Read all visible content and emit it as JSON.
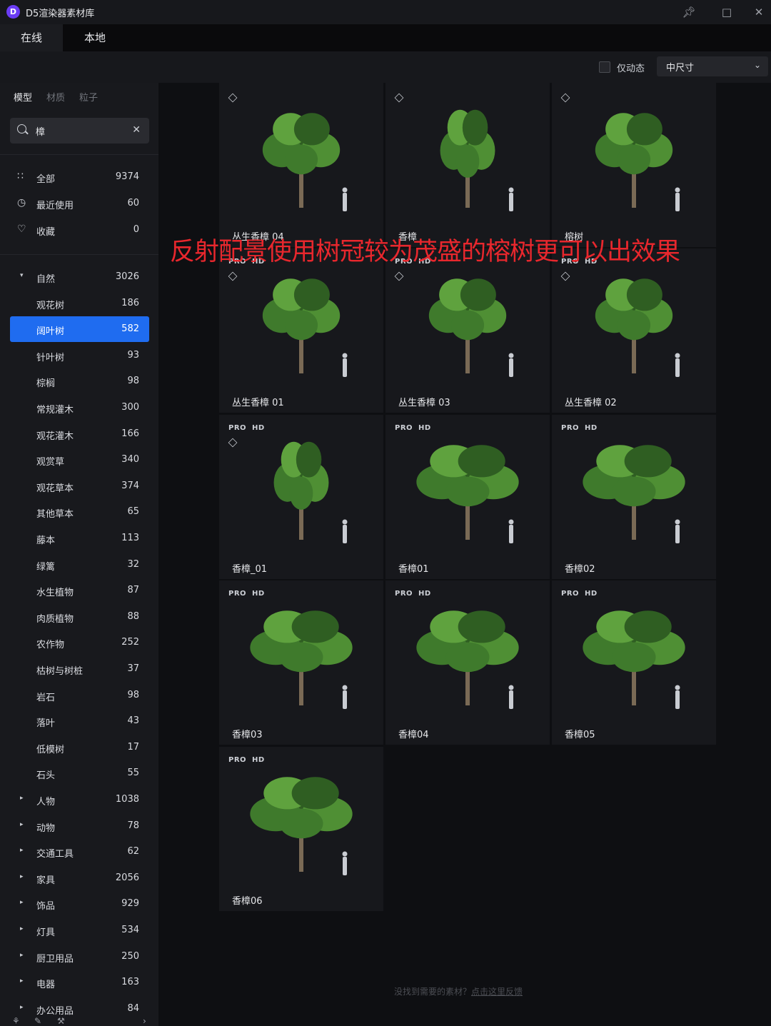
{
  "app": {
    "title": "D5渲染器素材库",
    "logo_letter": "D"
  },
  "tabs": [
    {
      "label": "在线"
    },
    {
      "label": "本地"
    }
  ],
  "toolbar": {
    "checkbox_label": "仅动态",
    "size_select": "中尺寸"
  },
  "sidebar": {
    "tabs": [
      {
        "label": "模型"
      },
      {
        "label": "材质"
      },
      {
        "label": "粒子"
      }
    ],
    "search": {
      "value": "樟"
    },
    "top_items": [
      {
        "label": "全部",
        "count": "9374"
      },
      {
        "label": "最近使用",
        "count": "60"
      },
      {
        "label": "收藏",
        "count": "0"
      }
    ],
    "categories": [
      {
        "label": "自然",
        "count": "3026"
      },
      {
        "label": "观花树",
        "count": "186"
      },
      {
        "label": "阔叶树",
        "count": "582"
      },
      {
        "label": "针叶树",
        "count": "93"
      },
      {
        "label": "棕榈",
        "count": "98"
      },
      {
        "label": "常规灌木",
        "count": "300"
      },
      {
        "label": "观花灌木",
        "count": "166"
      },
      {
        "label": "观赏草",
        "count": "340"
      },
      {
        "label": "观花草本",
        "count": "374"
      },
      {
        "label": "其他草本",
        "count": "65"
      },
      {
        "label": "藤本",
        "count": "113"
      },
      {
        "label": "绿篱",
        "count": "32"
      },
      {
        "label": "水生植物",
        "count": "87"
      },
      {
        "label": "肉质植物",
        "count": "88"
      },
      {
        "label": "农作物",
        "count": "252"
      },
      {
        "label": "枯树与树桩",
        "count": "37"
      },
      {
        "label": "岩石",
        "count": "98"
      },
      {
        "label": "落叶",
        "count": "43"
      },
      {
        "label": "低模树",
        "count": "17"
      },
      {
        "label": "石头",
        "count": "55"
      },
      {
        "label": "人物",
        "count": "1038"
      },
      {
        "label": "动物",
        "count": "78"
      },
      {
        "label": "交通工具",
        "count": "62"
      },
      {
        "label": "家具",
        "count": "2056"
      },
      {
        "label": "饰品",
        "count": "929"
      },
      {
        "label": "灯具",
        "count": "534"
      },
      {
        "label": "厨卫用品",
        "count": "250"
      },
      {
        "label": "电器",
        "count": "163"
      },
      {
        "label": "办公用品",
        "count": "84"
      }
    ]
  },
  "assets": [
    {
      "name": "丛生香樟 04",
      "pro": "",
      "hd": ""
    },
    {
      "name": "香樟",
      "pro": "",
      "hd": ""
    },
    {
      "name": "榕树",
      "pro": "",
      "hd": ""
    },
    {
      "name": "丛生香樟 01",
      "pro": "PRO",
      "hd": "HD"
    },
    {
      "name": "丛生香樟 03",
      "pro": "PRO",
      "hd": "HD"
    },
    {
      "name": "丛生香樟 02",
      "pro": "PRO",
      "hd": "HD"
    },
    {
      "name": "香樟_01",
      "pro": "PRO",
      "hd": "HD"
    },
    {
      "name": "香樟01",
      "pro": "PRO",
      "hd": "HD"
    },
    {
      "name": "香樟02",
      "pro": "PRO",
      "hd": "HD"
    },
    {
      "name": "香樟03",
      "pro": "PRO",
      "hd": "HD"
    },
    {
      "name": "香樟04",
      "pro": "PRO",
      "hd": "HD"
    },
    {
      "name": "香樟05",
      "pro": "PRO",
      "hd": "HD"
    },
    {
      "name": "香樟06",
      "pro": "PRO",
      "hd": "HD"
    }
  ],
  "feedback": {
    "question": "没找到需要的素材？",
    "link": "点击这里反馈"
  },
  "overlay_caption": "反射配景使用树冠较为茂盛的榕树更可以出效果",
  "colors": {
    "accent": "#1f6cf0",
    "caption": "#e8272d",
    "foliage": "#3f7a2c"
  },
  "icons": {
    "pin": "pin-icon",
    "maximize": "maximize-icon",
    "close": "close-icon",
    "model_3d": "cube-icon",
    "person_scale": "person-silhouette-icon"
  }
}
